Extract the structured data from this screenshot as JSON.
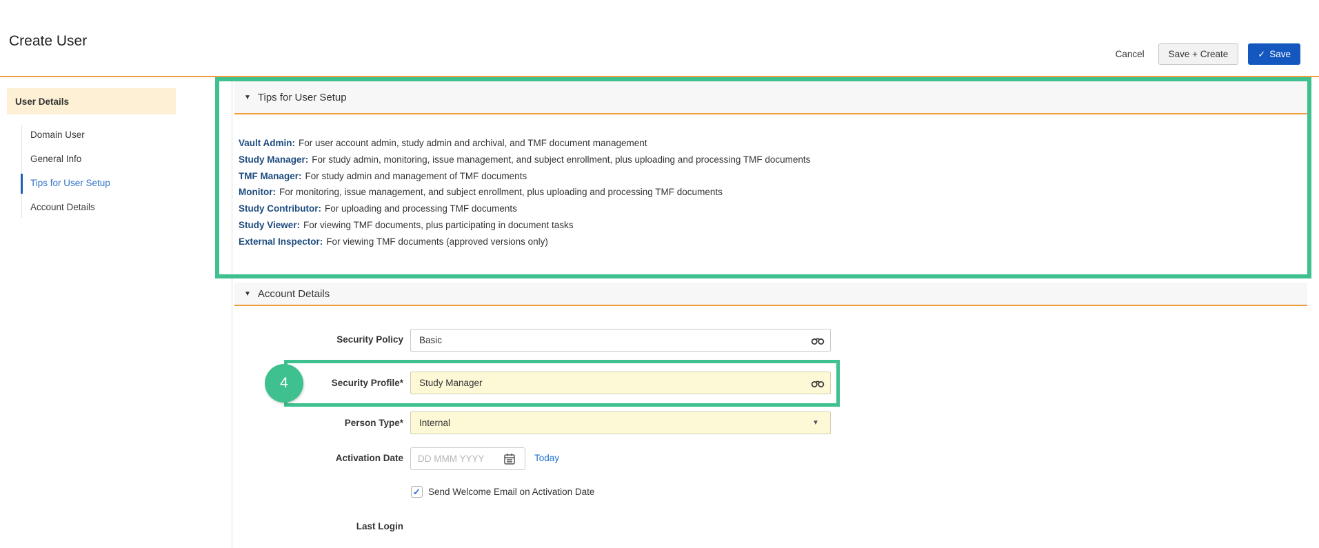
{
  "header": {
    "title": "Create User",
    "cancel_label": "Cancel",
    "save_create_label": "Save + Create",
    "save_label": "Save"
  },
  "sidebar": {
    "section_label": "User Details",
    "items": [
      {
        "label": "Domain User",
        "active": false
      },
      {
        "label": "General Info",
        "active": false
      },
      {
        "label": "Tips for User Setup",
        "active": true
      },
      {
        "label": "Account Details",
        "active": false
      }
    ]
  },
  "tips": {
    "title": "Tips for User Setup",
    "items": [
      {
        "role": "Vault Admin:",
        "desc": "For user account admin, study admin and archival, and TMF document management"
      },
      {
        "role": "Study Manager:",
        "desc": "For study admin, monitoring, issue management, and subject enrollment, plus uploading and processing TMF documents"
      },
      {
        "role": "TMF Manager:",
        "desc": "For study admin and management of TMF documents"
      },
      {
        "role": "Monitor:",
        "desc": "For monitoring, issue management, and subject enrollment, plus uploading and processing TMF documents"
      },
      {
        "role": "Study Contributor:",
        "desc": "For uploading and processing TMF documents"
      },
      {
        "role": "Study Viewer:",
        "desc": "For viewing TMF documents, plus participating in document tasks"
      },
      {
        "role": "External Inspector:",
        "desc": "For viewing TMF documents (approved versions only)"
      }
    ]
  },
  "account": {
    "title": "Account Details",
    "required_marker": "*",
    "fields": {
      "security_policy": {
        "label": "Security Policy",
        "value": "Basic",
        "required": false
      },
      "security_profile": {
        "label": "Security Profile",
        "value": "Study Manager",
        "required": true
      },
      "person_type": {
        "label": "Person Type",
        "value": "Internal",
        "required": true
      },
      "activation_date": {
        "label": "Activation Date",
        "placeholder": "DD MMM YYYY",
        "today_label": "Today"
      },
      "welcome_email": {
        "label": "Send Welcome Email on Activation Date",
        "checked": true
      },
      "last_login": {
        "label": "Last Login",
        "value": ""
      }
    }
  },
  "annotation": {
    "step_number": "4"
  },
  "icons": {
    "section_collapse": "▼",
    "dropdown_caret": "▼",
    "checkbox_check": "✓",
    "save_check": "✓",
    "binoculars": "css-shape",
    "calendar": "css-shape"
  },
  "colors": {
    "annotation_green": "#3fc08f",
    "accent_orange": "#f09d3c",
    "save_button_blue": "#1457be",
    "active_link_blue": "#2e71c7",
    "tips_role_navy": "#1d4b7e",
    "required_field_yellow": "#fdf9d6",
    "sidebar_header_cream": "#fdf0d5"
  }
}
